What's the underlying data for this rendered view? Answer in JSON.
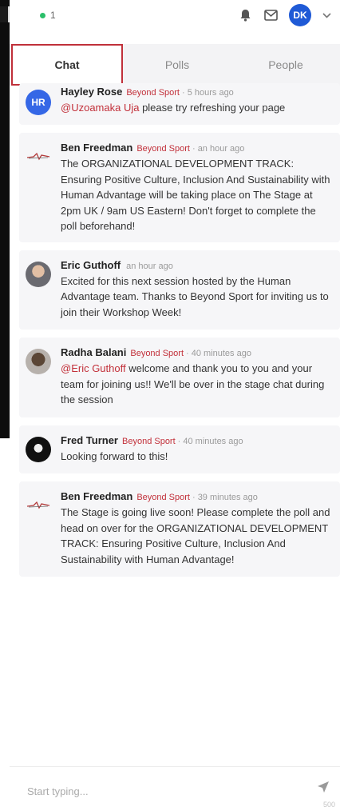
{
  "header": {
    "online_count": "1",
    "avatar_initials": "DK"
  },
  "tabs": [
    {
      "label": "Chat"
    },
    {
      "label": "Polls"
    },
    {
      "label": "People"
    }
  ],
  "messages": [
    {
      "name": "Hayley Rose",
      "org": "Beyond Sport",
      "time": "· 5 hours ago",
      "mention": "@Uzoamaka Uja",
      "text": " please try refreshing your page",
      "avatar_initials": "HR"
    },
    {
      "name": "Ben Freedman",
      "org": "Beyond Sport",
      "time": "· an hour ago",
      "mention": "",
      "text": "The ORGANIZATIONAL DEVELOPMENT TRACK: Ensuring Positive Culture, Inclusion And Sustainability with Human Advantage will be taking place on The Stage at 2pm UK / 9am US Eastern! Don't forget to complete the poll beforehand!"
    },
    {
      "name": "Eric Guthoff",
      "org": "",
      "time": "an hour ago",
      "mention": "",
      "text": "Excited for this next session hosted by the Human Advantage team. Thanks to Beyond Sport for inviting us to join their Workshop Week!"
    },
    {
      "name": "Radha Balani",
      "org": "Beyond Sport",
      "time": "· 40 minutes ago",
      "mention": "@Eric Guthoff",
      "text": " welcome and thank you to you and your team for joining us!! We'll be over in the stage chat during the session"
    },
    {
      "name": "Fred Turner",
      "org": "Beyond Sport",
      "time": "· 40 minutes ago",
      "mention": "",
      "text": "Looking forward to this!"
    },
    {
      "name": "Ben Freedman",
      "org": "Beyond Sport",
      "time": "· 39 minutes ago",
      "mention": "",
      "text": "The Stage is going live soon! Please complete the poll and head on over for the ORGANIZATIONAL DEVELOPMENT TRACK: Ensuring Positive Culture, Inclusion And Sustainability with Human Advantage!"
    }
  ],
  "composer": {
    "placeholder": "Start typing...",
    "char_count": "500"
  },
  "colors": {
    "brand_red": "#c2303a",
    "online_green": "#2bbf6a",
    "avatar_blue": "#1f5ad6"
  },
  "icons": [
    "bell-icon",
    "mail-icon",
    "chevron-down-icon",
    "send-icon",
    "brand-logo-icon"
  ]
}
